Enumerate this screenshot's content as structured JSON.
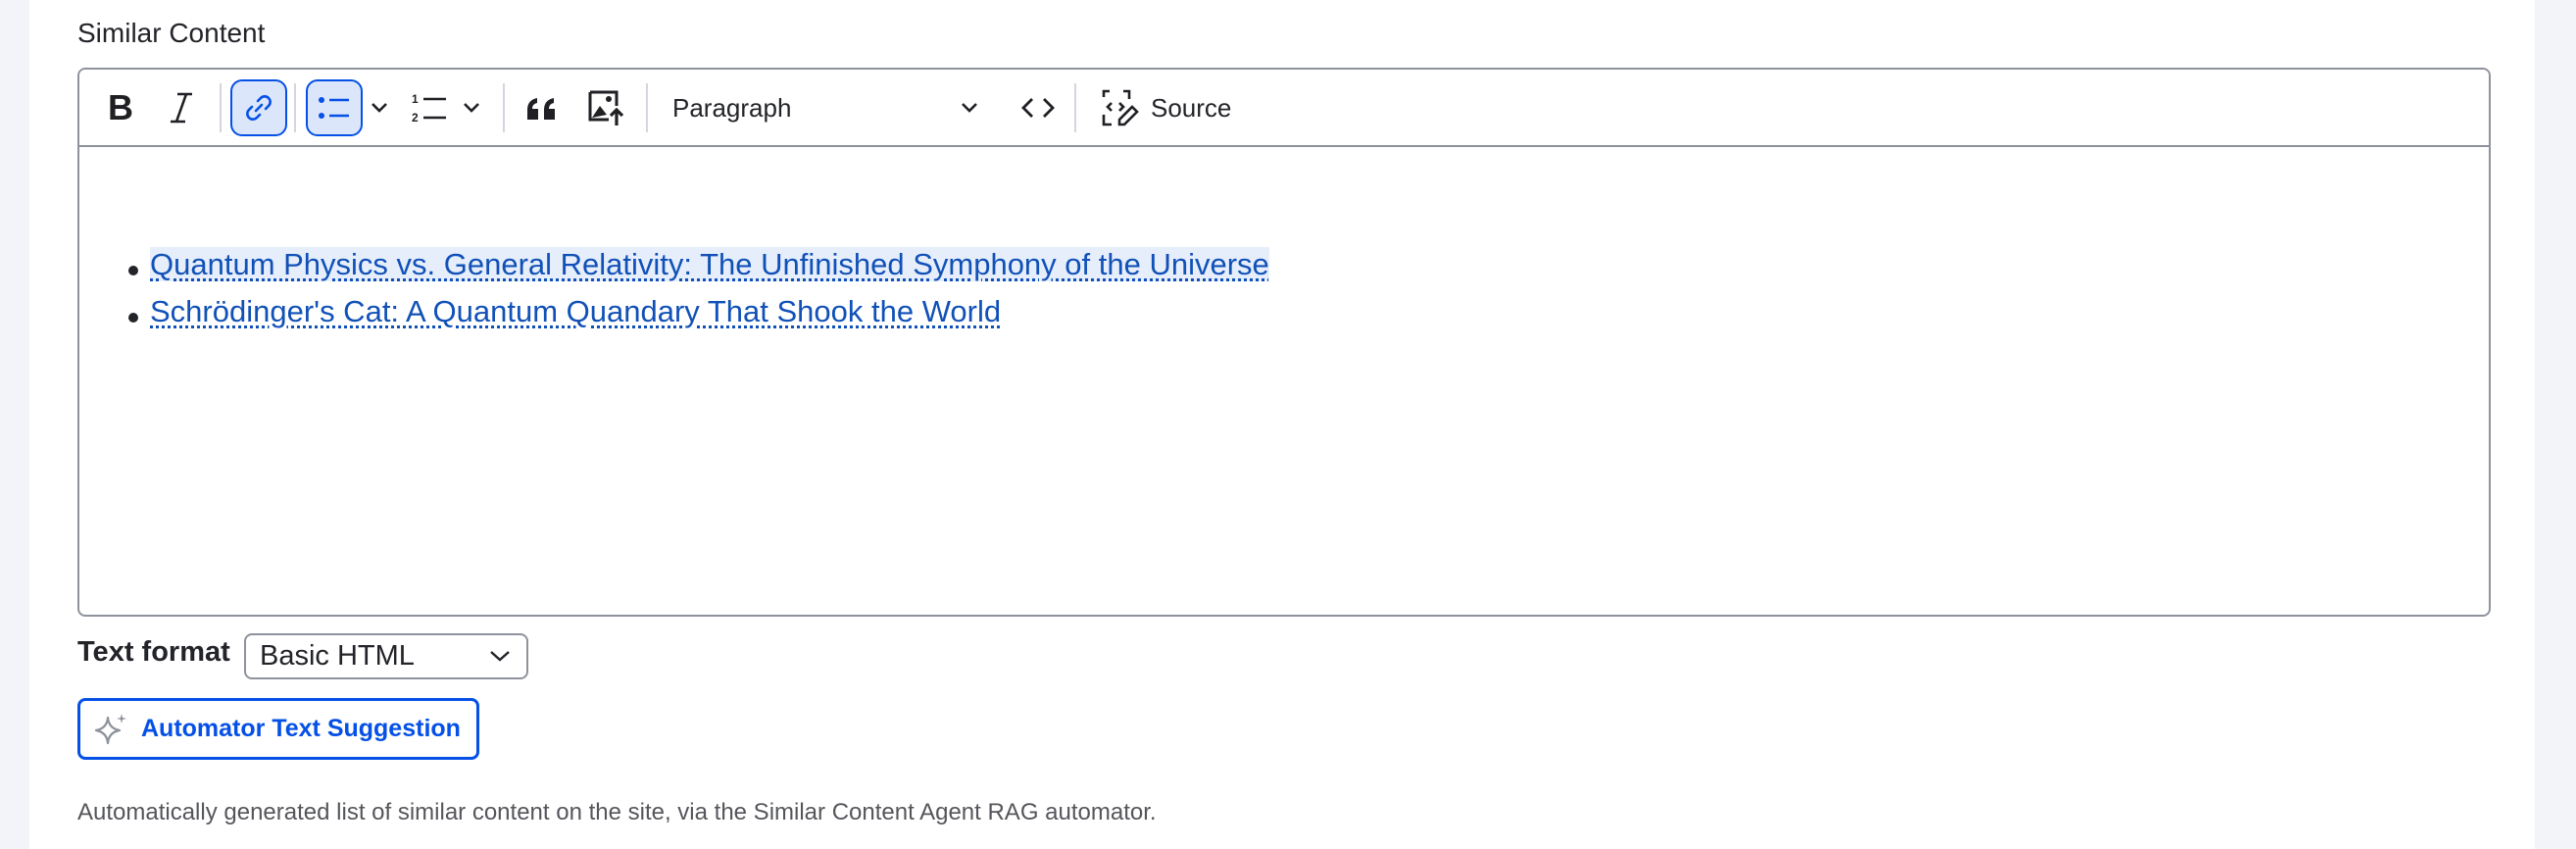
{
  "field": {
    "label": "Similar Content"
  },
  "toolbar": {
    "bold_label": "B",
    "format_select": {
      "selected": "Paragraph"
    },
    "source_label": "Source"
  },
  "content": {
    "items": [
      {
        "text": "Quantum Physics vs. General Relativity: The Unfinished Symphony of the Universe",
        "selected": true
      },
      {
        "text": "Schrödinger's Cat: A Quantum Quandary That Shook the World",
        "selected": false
      }
    ]
  },
  "text_format": {
    "label": "Text format",
    "selected": "Basic HTML"
  },
  "automator_button": {
    "label": "Automator Text Suggestion"
  },
  "description": "Automatically generated list of similar content on the site, via the Similar Content Agent RAG automator.",
  "colors": {
    "accent": "#0550e6",
    "link": "#1151b7",
    "active_bg": "#dbe6fb",
    "border": "#8e929c"
  }
}
